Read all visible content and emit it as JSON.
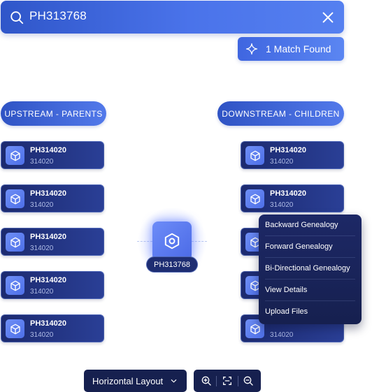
{
  "search": {
    "query": "PH313768"
  },
  "match": {
    "label": "1 Match Found"
  },
  "columns": {
    "upstream_label": "UPSTREAM - PARENTS",
    "downstream_label": "DOWNSTREAM - CHILDREN"
  },
  "upstream": [
    {
      "title": "PH314020",
      "sub": "314020"
    },
    {
      "title": "PH314020",
      "sub": "314020"
    },
    {
      "title": "PH314020",
      "sub": "314020"
    },
    {
      "title": "PH314020",
      "sub": "314020"
    },
    {
      "title": "PH314020",
      "sub": "314020"
    }
  ],
  "downstream": [
    {
      "title": "PH314020",
      "sub": "314020"
    },
    {
      "title": "PH314020",
      "sub": "314020"
    },
    {
      "title": "",
      "sub": ""
    },
    {
      "title": "",
      "sub": ""
    },
    {
      "title": "",
      "sub": "314020"
    }
  ],
  "center": {
    "label": "PH313768"
  },
  "context_menu": {
    "items": [
      "Backward Genealogy",
      "Forward Genealogy",
      "Bi-Directional Genealogy",
      "View Details",
      "Upload Files"
    ]
  },
  "toolbar": {
    "layout_label": "Horizontal Layout"
  },
  "icons": {
    "search": "search-icon",
    "close": "close-icon",
    "sparkle": "sparkle-icon",
    "node": "cube-icon",
    "center": "hexagon-icon",
    "chevron": "chevron-down-icon",
    "zoom_in": "zoom-in-icon",
    "fit": "fit-view-icon",
    "zoom_out": "zoom-out-icon"
  },
  "colors": {
    "primary": "#3f66e0",
    "dark": "#16204f",
    "node": "#1c2a6f"
  }
}
